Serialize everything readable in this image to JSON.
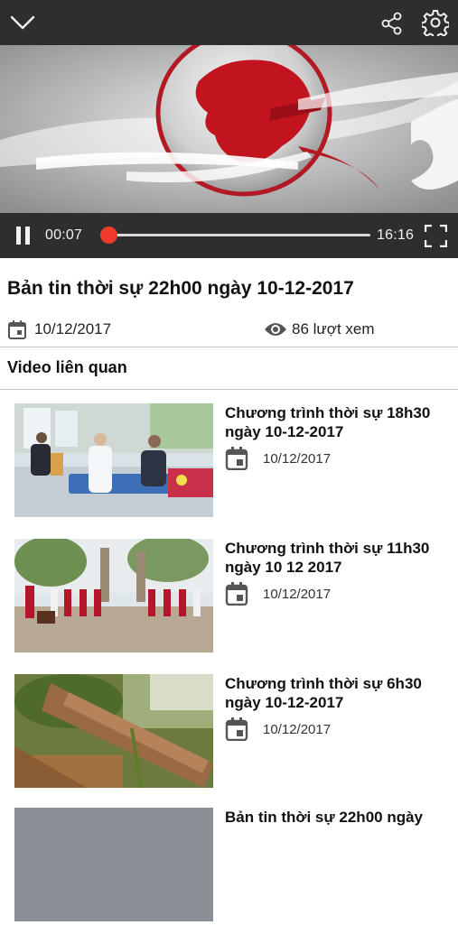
{
  "player": {
    "current_time": "00:07",
    "duration": "16:16",
    "progress": 0.007
  },
  "video": {
    "title": "Bản tin thời sự 22h00 ngày 10-12-2017",
    "date": "10/12/2017",
    "views": "86 lượt xem"
  },
  "related": {
    "heading": "Video liên quan",
    "items": [
      {
        "title": "Chương trình thời sự 18h30 ngày 10-12-2017",
        "date": "10/12/2017"
      },
      {
        "title": "Chương trình thời sự 11h30 ngày 10 12 2017",
        "date": "10/12/2017"
      },
      {
        "title": "Chương trình thời sự 6h30 ngày 10-12-2017",
        "date": "10/12/2017"
      },
      {
        "title": "Bản tin thời sự 22h00 ngày",
        "date": ""
      }
    ]
  },
  "colors": {
    "accent_red": "#f03a2e",
    "player_bar": "#2e2e2e",
    "icon_gray": "#555555"
  },
  "icons": [
    "chevron-down-icon",
    "share-icon",
    "gear-icon",
    "pause-icon",
    "fullscreen-icon",
    "calendar-icon",
    "eye-icon"
  ]
}
